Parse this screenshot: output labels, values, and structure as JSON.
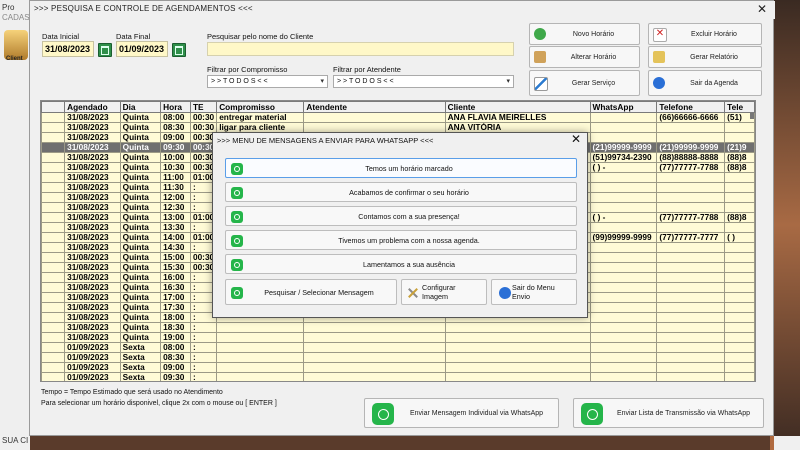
{
  "bg": {
    "title_fragment": "Pro",
    "menu_fragment": "CADAS",
    "icon_label": "Client",
    "status_fragment": "SUA CI"
  },
  "window": {
    "title": ">>> PESQUISA E CONTROLE DE AGENDAMENTOS <<<",
    "close": "✕"
  },
  "filters": {
    "data_inicial_label": "Data Inicial",
    "data_inicial": "31/08/2023",
    "data_final_label": "Data Final",
    "data_final": "01/09/2023",
    "search_label": "Pesquisar pelo nome do Cliente",
    "search_value": "",
    "compromisso_label": "Filtrar por Compromisso",
    "compromisso_value": "> > T O D O S < <",
    "atendente_label": "Filtrar por Atendente",
    "atendente_value": "> > T O D O S < <"
  },
  "actions": {
    "novo": "Novo Horário",
    "alterar": "Alterar Horário",
    "gerar_servico": "Gerar  Serviço",
    "excluir": "Excluir Horário",
    "relatorio": "Gerar Relatório",
    "sair": "Sair da Agenda"
  },
  "table": {
    "columns": [
      "",
      "Agendado",
      "Dia",
      "Hora",
      "TE",
      "Compromisso",
      "Atendente",
      "Cliente",
      "WhatsApp",
      "Telefone",
      "Tele"
    ],
    "rows": [
      [
        "",
        "31/08/2023",
        "Quinta",
        "08:00",
        "00:30",
        "entregar material",
        "",
        "ANA FLAVIA MEIRELLES",
        "",
        "(66)66666-6666",
        "(51)"
      ],
      [
        "",
        "31/08/2023",
        "Quinta",
        "08:30",
        "00:30",
        "ligar para cliente",
        "",
        "ANA VITÓRIA",
        "",
        "",
        ""
      ],
      [
        "",
        "31/08/2023",
        "Quinta",
        "09:00",
        "00:30",
        "",
        "",
        "",
        "",
        "",
        ""
      ],
      [
        "",
        "31/08/2023",
        "Quinta",
        "09:30",
        "00:30",
        "",
        "",
        "",
        "(21)99999-9999",
        "(21)99999-9999",
        "(21)9"
      ],
      [
        "",
        "31/08/2023",
        "Quinta",
        "10:00",
        "00:30",
        "",
        "",
        "",
        "(51)99734-2390",
        "(88)88888-8888",
        "(88)8"
      ],
      [
        "",
        "31/08/2023",
        "Quinta",
        "10:30",
        "00:30",
        "",
        "",
        "",
        "(  )      -",
        "(77)77777-7788",
        "(88)8"
      ],
      [
        "",
        "31/08/2023",
        "Quinta",
        "11:00",
        "01:00",
        "",
        "",
        "",
        "",
        "",
        ""
      ],
      [
        "",
        "31/08/2023",
        "Quinta",
        "11:30",
        ":",
        "",
        "",
        "",
        "",
        "",
        ""
      ],
      [
        "",
        "31/08/2023",
        "Quinta",
        "12:00",
        ":",
        "",
        "",
        "",
        "",
        "",
        ""
      ],
      [
        "",
        "31/08/2023",
        "Quinta",
        "12:30",
        ":",
        "",
        "",
        "",
        "",
        "",
        ""
      ],
      [
        "",
        "31/08/2023",
        "Quinta",
        "13:00",
        "01:00",
        "",
        "",
        "",
        "(  )      -",
        "(77)77777-7788",
        "(88)8"
      ],
      [
        "",
        "31/08/2023",
        "Quinta",
        "13:30",
        ":",
        "",
        "",
        "",
        "",
        "",
        ""
      ],
      [
        "",
        "31/08/2023",
        "Quinta",
        "14:00",
        "01:00",
        "",
        "",
        "",
        "(99)99999-9999",
        "(77)77777-7777",
        "(  )"
      ],
      [
        "",
        "31/08/2023",
        "Quinta",
        "14:30",
        ":",
        "",
        "",
        "",
        "",
        "",
        ""
      ],
      [
        "",
        "31/08/2023",
        "Quinta",
        "15:00",
        "00:30",
        "",
        "",
        "",
        "",
        "",
        ""
      ],
      [
        "",
        "31/08/2023",
        "Quinta",
        "15:30",
        "00:30",
        "",
        "",
        "",
        "",
        "",
        ""
      ],
      [
        "",
        "31/08/2023",
        "Quinta",
        "16:00",
        ":",
        "",
        "",
        "",
        "",
        "",
        ""
      ],
      [
        "",
        "31/08/2023",
        "Quinta",
        "16:30",
        ":",
        "",
        "",
        "",
        "",
        "",
        ""
      ],
      [
        "",
        "31/08/2023",
        "Quinta",
        "17:00",
        ":",
        "",
        "",
        "",
        "",
        "",
        ""
      ],
      [
        "",
        "31/08/2023",
        "Quinta",
        "17:30",
        ":",
        "",
        "",
        "",
        "",
        "",
        ""
      ],
      [
        "",
        "31/08/2023",
        "Quinta",
        "18:00",
        ":",
        "",
        "",
        "",
        "",
        "",
        ""
      ],
      [
        "",
        "31/08/2023",
        "Quinta",
        "18:30",
        ":",
        "",
        "",
        "",
        "",
        "",
        ""
      ],
      [
        "",
        "31/08/2023",
        "Quinta",
        "19:00",
        ":",
        "",
        "",
        "",
        "",
        "",
        ""
      ],
      [
        "",
        "01/09/2023",
        "Sexta",
        "08:00",
        ":",
        "",
        "",
        "",
        "",
        "",
        ""
      ],
      [
        "",
        "01/09/2023",
        "Sexta",
        "08:30",
        ":",
        "",
        "",
        "",
        "",
        "",
        ""
      ],
      [
        "",
        "01/09/2023",
        "Sexta",
        "09:00",
        ":",
        "",
        "",
        "",
        "",
        "",
        ""
      ],
      [
        "",
        "01/09/2023",
        "Sexta",
        "09:30",
        ":",
        "",
        "",
        "",
        "",
        "",
        ""
      ]
    ],
    "selected_row_index": 3
  },
  "footer": {
    "line1": "Tempo = Tempo Estimado que será usado no Atendimento",
    "line2": "Para selecionar um horário disponivel, clique 2x com o mouse ou [ ENTER ]",
    "btn_individual": "Enviar Mensagem Individual via WhatsApp",
    "btn_lista": "Enviar Lista de Transmissão via WhatsApp"
  },
  "modal": {
    "title": ">>> MENU DE MENSAGENS A ENVIAR PARA WHATSAPP <<<",
    "close": "✕",
    "options": [
      "Temos um horário marcado",
      "Acabamos de confirmar o seu horário",
      "Contamos com a sua presença!",
      "Tivemos um problema com a nossa agenda.",
      "Lamentamos a sua ausência"
    ],
    "pesquisar": "Pesquisar / Selecionar Mensagem",
    "configurar": "Configurar Imagem",
    "sair": "Sair do Menu Envio"
  }
}
